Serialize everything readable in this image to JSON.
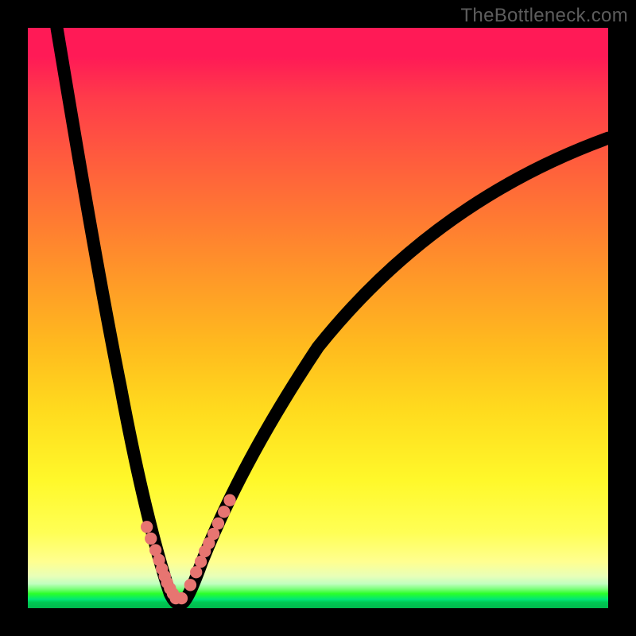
{
  "watermark": "TheBottleneck.com",
  "chart_data": {
    "type": "line",
    "title": "",
    "xlabel": "",
    "ylabel": "",
    "xlim": [
      0,
      100
    ],
    "ylim": [
      0,
      100
    ],
    "grid": false,
    "legend_position": "none",
    "series": [
      {
        "name": "left-curve",
        "x": [
          5,
          7,
          9,
          11,
          13,
          15,
          17,
          19,
          21,
          22.5,
          23.5,
          24.5,
          25.5
        ],
        "y": [
          100,
          90,
          77,
          63,
          50,
          38,
          27,
          18,
          11,
          7,
          4.5,
          2.5,
          1
        ]
      },
      {
        "name": "right-curve",
        "x": [
          26,
          27,
          29,
          31,
          34,
          38,
          43,
          50,
          58,
          67,
          77,
          88,
          100
        ],
        "y": [
          1,
          3,
          7,
          12,
          19,
          27,
          36,
          46,
          55,
          63,
          70,
          76,
          81
        ]
      },
      {
        "name": "markers",
        "x": [
          20.5,
          21.2,
          22.0,
          22.6,
          23.1,
          23.6,
          24.0,
          24.5,
          25.0,
          25.5,
          26.5,
          28.0,
          29.0,
          29.8,
          30.5,
          31.2,
          32.0,
          32.8,
          33.8,
          34.8
        ],
        "y": [
          14.0,
          12.0,
          10.0,
          8.3,
          6.8,
          5.5,
          4.4,
          3.4,
          2.5,
          1.7,
          1.7,
          4.0,
          6.2,
          8.0,
          9.8,
          11.2,
          12.8,
          14.6,
          16.6,
          18.6
        ]
      }
    ],
    "annotations": [],
    "background_gradient": [
      "#ff1a56",
      "#ff7a32",
      "#ffdb1e",
      "#ffff55",
      "#00c853"
    ]
  }
}
